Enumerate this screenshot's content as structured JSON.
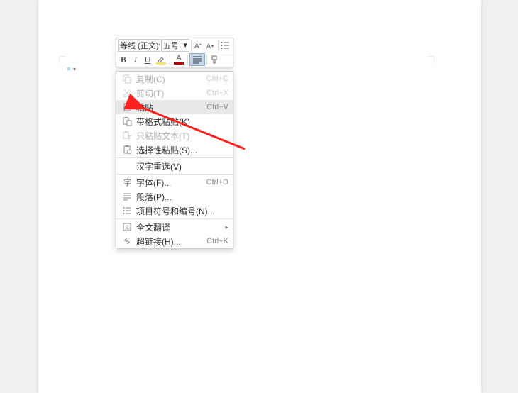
{
  "toolbar": {
    "font_name": "等线 (正文)",
    "font_size": "五号",
    "bold": "B",
    "italic": "I",
    "underline": "U"
  },
  "menu": {
    "items": [
      {
        "icon": "copy",
        "label": "复制(C)",
        "shortcut": "Ctrl+C",
        "disabled": true
      },
      {
        "icon": "cut",
        "label": "剪切(T)",
        "shortcut": "Ctrl+X",
        "disabled": true
      },
      {
        "icon": "paste",
        "label": "粘贴",
        "shortcut": "Ctrl+V",
        "highlighted": true
      },
      {
        "icon": "paste-format",
        "label": "带格式粘贴(K)",
        "shortcut": ""
      },
      {
        "icon": "paste-text",
        "label": "只粘贴文本(T)",
        "shortcut": "",
        "disabled": true
      },
      {
        "icon": "paste-special",
        "label": "选择性粘贴(S)...",
        "shortcut": ""
      },
      {
        "sep": true
      },
      {
        "icon": "",
        "label": "汉字重选(V)",
        "shortcut": ""
      },
      {
        "sep": true
      },
      {
        "icon": "font",
        "label": "字体(F)...",
        "shortcut": "Ctrl+D"
      },
      {
        "icon": "paragraph",
        "label": "段落(P)...",
        "shortcut": ""
      },
      {
        "icon": "bullets",
        "label": "项目符号和编号(N)...",
        "shortcut": ""
      },
      {
        "sep": true
      },
      {
        "icon": "translate",
        "label": "全文翻译",
        "shortcut": "",
        "submenu": true
      },
      {
        "icon": "link",
        "label": "超链接(H)...",
        "shortcut": "Ctrl+K"
      }
    ]
  }
}
